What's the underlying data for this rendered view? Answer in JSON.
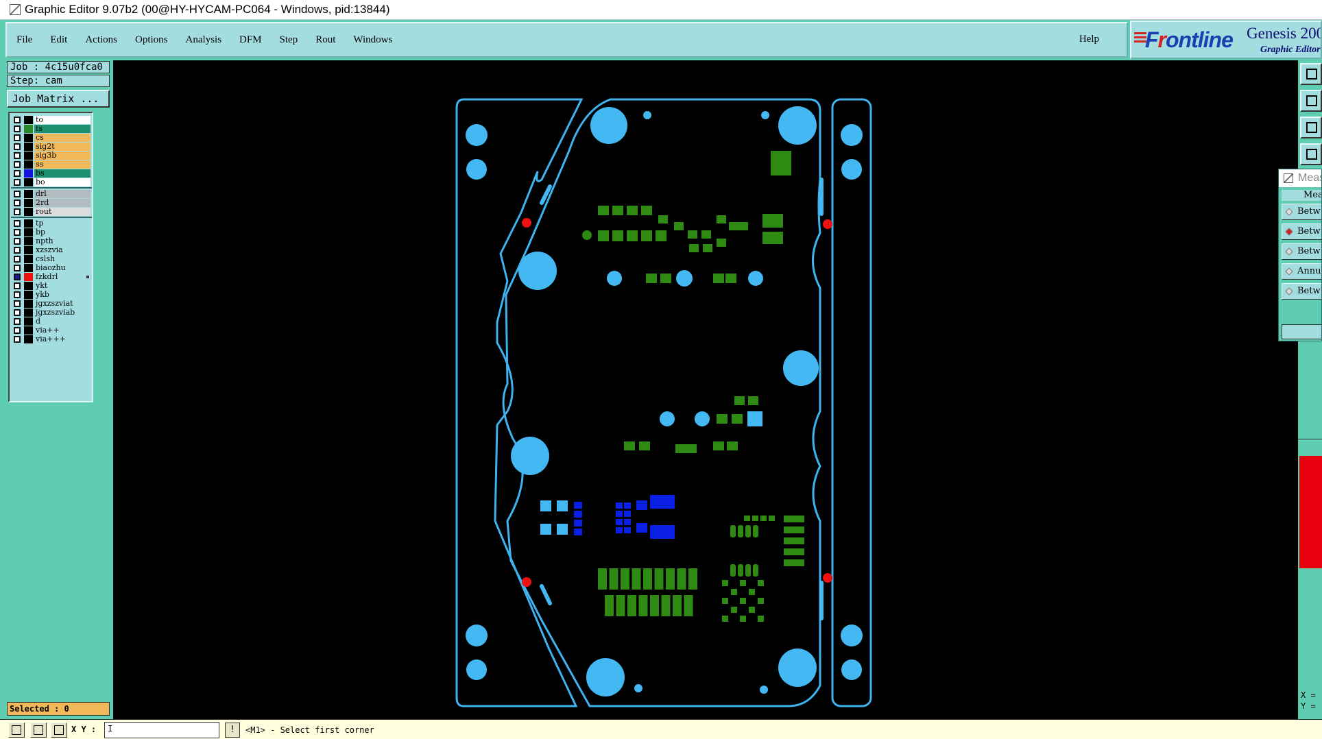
{
  "window": {
    "title": "Graphic Editor 9.07b2 (00@HY-HYCAM-PC064 - Windows, pid:13844)"
  },
  "menu": {
    "items": [
      {
        "label": "File"
      },
      {
        "label": "Edit"
      },
      {
        "label": "Actions"
      },
      {
        "label": "Options"
      },
      {
        "label": "Analysis"
      },
      {
        "label": "DFM"
      },
      {
        "label": "Step"
      },
      {
        "label": "Rout"
      },
      {
        "label": "Windows"
      }
    ],
    "help": "Help"
  },
  "logo": {
    "brand_a": "F",
    "brand_b": "r",
    "brand_c": "ontline",
    "product": "Genesis 200",
    "subtitle": "Graphic Editor"
  },
  "job": {
    "job_label": "Job : 4c15u0fca0",
    "step_label": "Step: cam",
    "matrix_button": "Job Matrix ..."
  },
  "layers": [
    {
      "name": "to",
      "color": "#ffffff",
      "swatch": "#000000",
      "on": false
    },
    {
      "name": "ts",
      "color": "#1e9070",
      "swatch": "#2a8a2a",
      "on": false
    },
    {
      "name": "cs",
      "color": "#f2b95a",
      "swatch": "#000000",
      "on": false
    },
    {
      "name": "sig2t",
      "color": "#f2b95a",
      "swatch": "#000000",
      "on": false
    },
    {
      "name": "sig3b",
      "color": "#f2b95a",
      "swatch": "#000000",
      "on": false
    },
    {
      "name": "ss",
      "color": "#f2b95a",
      "swatch": "#000000",
      "on": false
    },
    {
      "name": "bs",
      "color": "#1e9070",
      "swatch": "#1414e0",
      "on": false
    },
    {
      "name": "bo",
      "color": "#ffffff",
      "swatch": "#000000",
      "on": false
    },
    {
      "name": "drl",
      "color": "#b0bcc0",
      "swatch": "#000000",
      "on": false
    },
    {
      "name": "2rd",
      "color": "#b0bcc0",
      "swatch": "#000000",
      "on": false
    },
    {
      "name": "rout",
      "color": "#dcdcdc",
      "swatch": "#000000",
      "on": false
    },
    {
      "name": "tp",
      "color": "#a4dde0",
      "swatch": "#000000",
      "on": false
    },
    {
      "name": "bp",
      "color": "#a4dde0",
      "swatch": "#000000",
      "on": false
    },
    {
      "name": "npth",
      "color": "#a4dde0",
      "swatch": "#000000",
      "on": false
    },
    {
      "name": "xzszvia",
      "color": "#a4dde0",
      "swatch": "#000000",
      "on": false
    },
    {
      "name": "cslsh",
      "color": "#a4dde0",
      "swatch": "#000000",
      "on": false
    },
    {
      "name": "biaozhu",
      "color": "#a4dde0",
      "swatch": "#000000",
      "on": false
    },
    {
      "name": "fzkdrl",
      "color": "#a4dde0",
      "swatch": "#ee1111",
      "on": true
    },
    {
      "name": "ykt",
      "color": "#a4dde0",
      "swatch": "#000000",
      "on": false
    },
    {
      "name": "ykb",
      "color": "#a4dde0",
      "swatch": "#000000",
      "on": false
    },
    {
      "name": "jgxzszviat",
      "color": "#a4dde0",
      "swatch": "#000000",
      "on": false
    },
    {
      "name": "jgxzszviab",
      "color": "#a4dde0",
      "swatch": "#000000",
      "on": false
    },
    {
      "name": "d",
      "color": "#a4dde0",
      "swatch": "#000000",
      "on": false
    },
    {
      "name": "via++",
      "color": "#a4dde0",
      "swatch": "#000000",
      "on": false
    },
    {
      "name": "via+++",
      "color": "#a4dde0",
      "swatch": "#000000",
      "on": false
    }
  ],
  "selected": "Selected : 0",
  "measure": {
    "title": "Meas",
    "header": "Mea",
    "rows": [
      {
        "label": "Betw",
        "active": false
      },
      {
        "label": "Betw",
        "active": true
      },
      {
        "label": "Betw",
        "active": false
      },
      {
        "label": "Annul",
        "active": false
      },
      {
        "label": "Betw",
        "active": false
      }
    ]
  },
  "coords": {
    "x": "X =",
    "y": "Y ="
  },
  "bottombar": {
    "xy_label": "X Y :",
    "xy_value": "I",
    "exclaim": "!",
    "status": "<M1> - Select first corner"
  },
  "colors": {
    "outline": "#3fb2f0",
    "pad_cyan": "#44b8f2",
    "pad_green": "#2f8a14",
    "pad_blue": "#0a20e6",
    "marker_red": "#ee1111",
    "canvas_bg": "#000000"
  }
}
